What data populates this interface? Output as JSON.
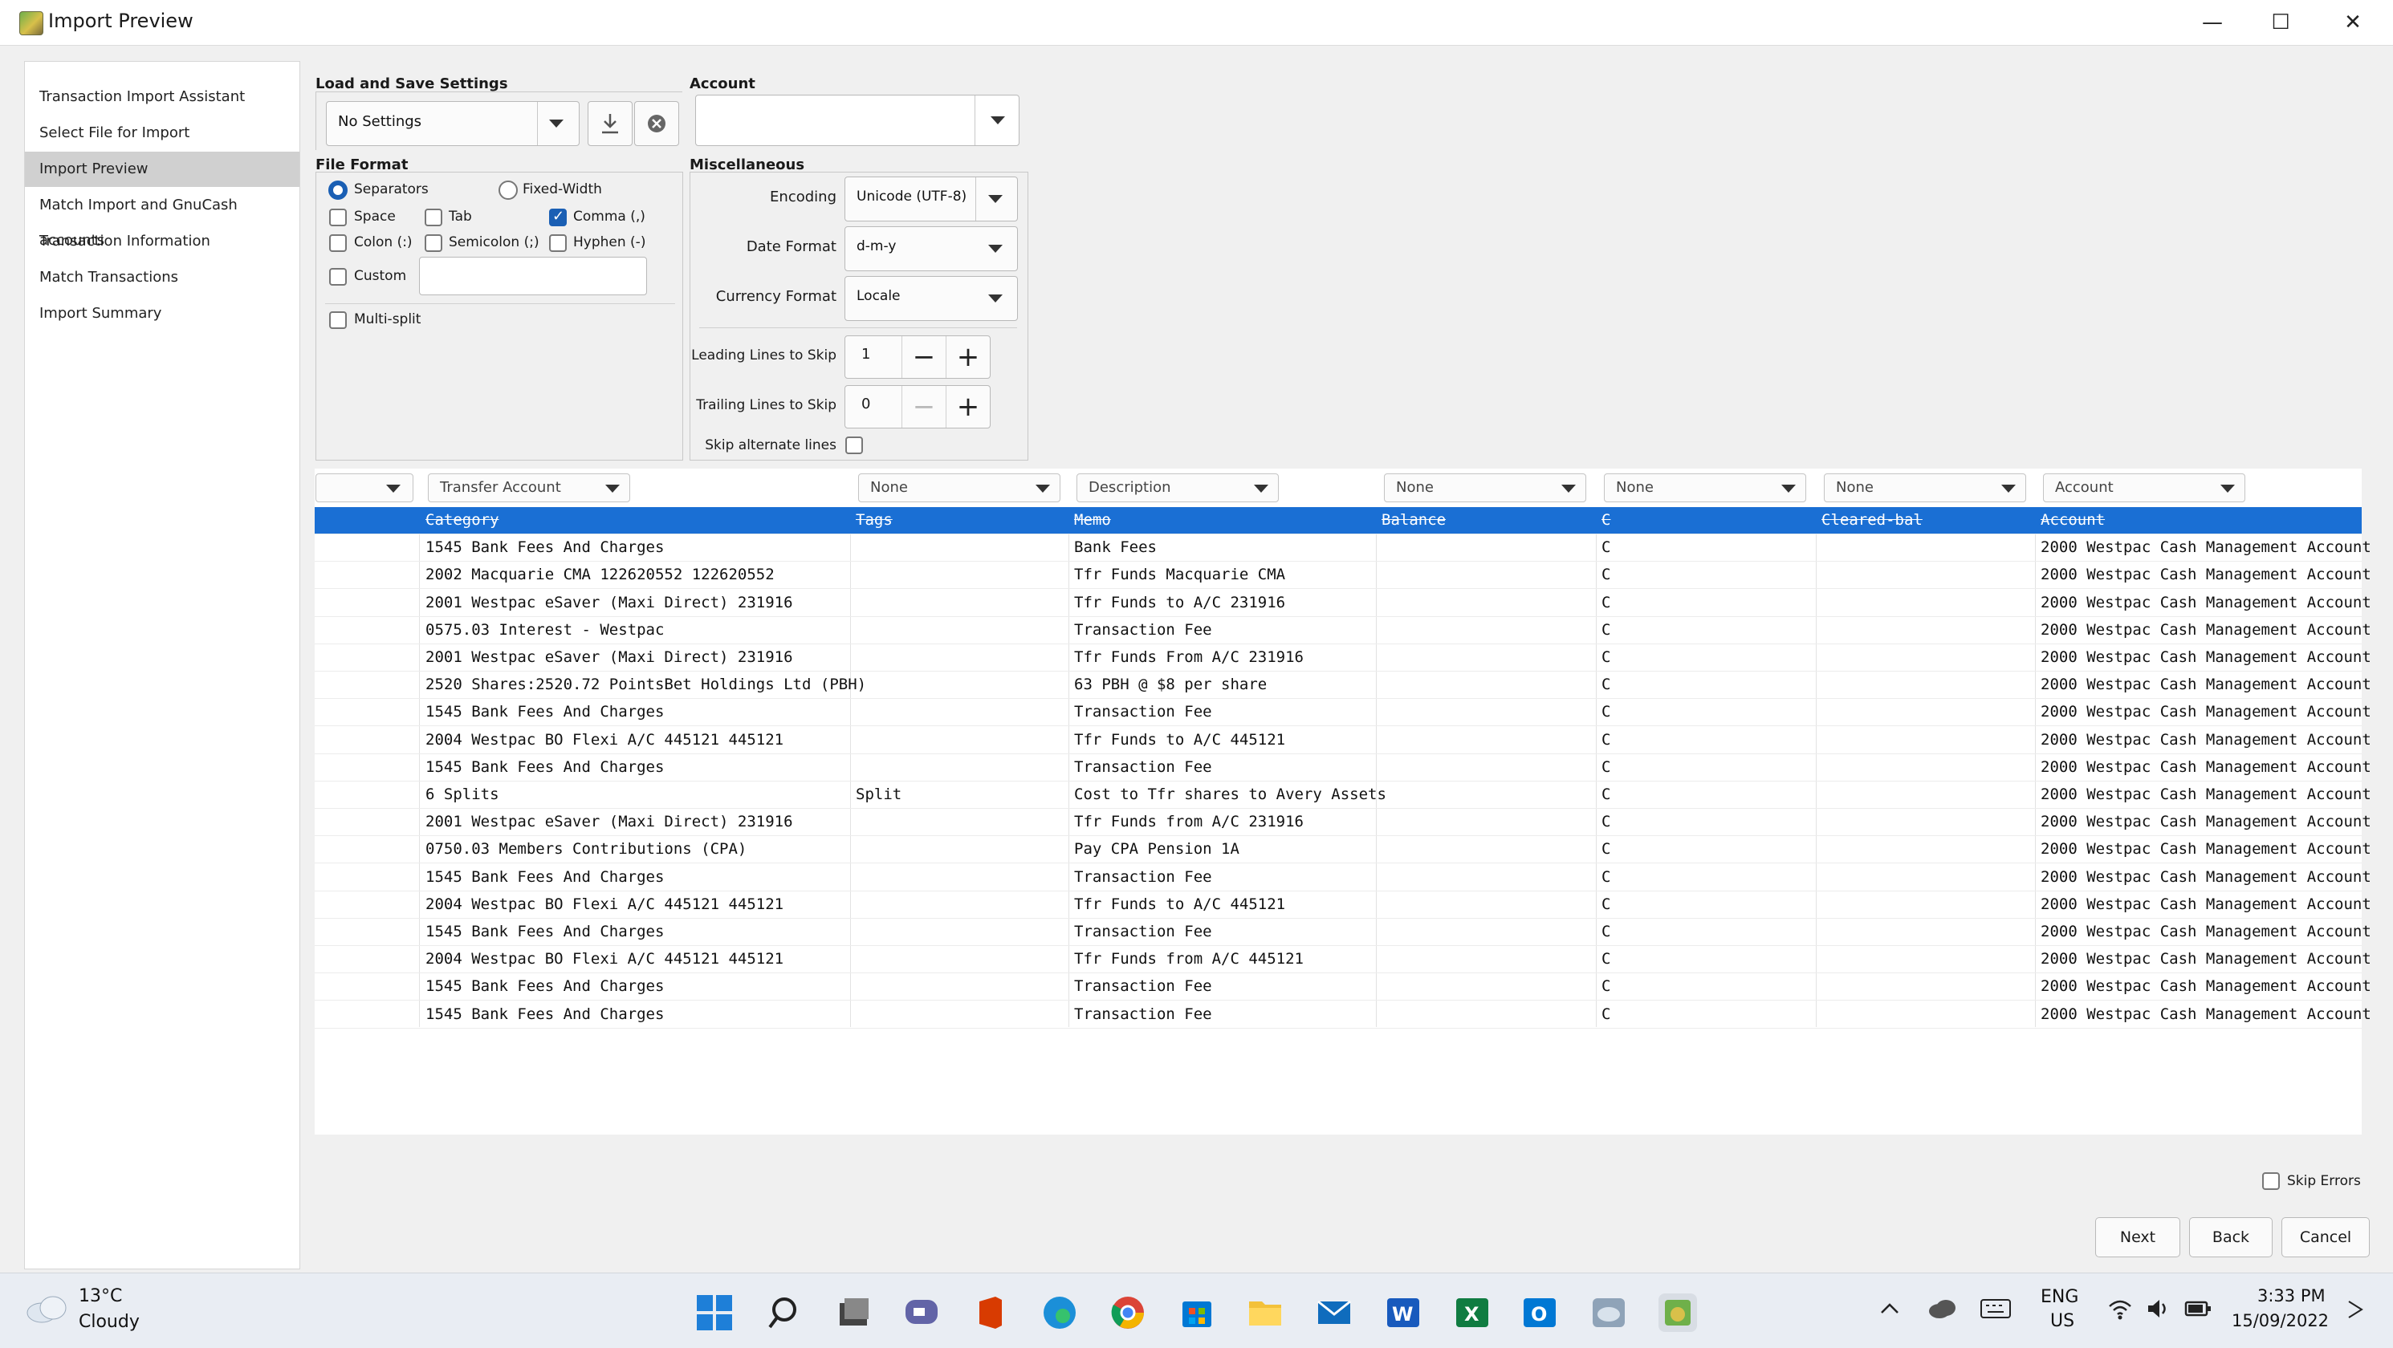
{
  "window": {
    "title": "Import Preview",
    "minimize": "—",
    "maximize": "☐",
    "close": "✕"
  },
  "sidebar": {
    "items": [
      {
        "label": "Transaction Import Assistant"
      },
      {
        "label": "Select File for Import"
      },
      {
        "label": "Import Preview"
      },
      {
        "label": "Match Import and GnuCash accounts"
      },
      {
        "label": "Transaction Information"
      },
      {
        "label": "Match Transactions"
      },
      {
        "label": "Import Summary"
      }
    ],
    "active_index": 2
  },
  "load_save": {
    "label": "Load and Save Settings",
    "value": "No Settings"
  },
  "account": {
    "label": "Account",
    "value": ""
  },
  "file_format": {
    "label": "File Format",
    "separators_label": "Separators",
    "fixed_width_label": "Fixed-Width",
    "separators_selected": true,
    "space_label": "Space",
    "tab_label": "Tab",
    "comma_label": "Comma (,)",
    "colon_label": "Colon (:)",
    "semicolon_label": "Semicolon (;)",
    "hyphen_label": "Hyphen (-)",
    "custom_label": "Custom",
    "custom_value": "",
    "multisplit_label": "Multi-split",
    "checked": {
      "space": false,
      "tab": false,
      "comma": true,
      "colon": false,
      "semicolon": false,
      "hyphen": false,
      "custom": false,
      "multisplit": false
    }
  },
  "misc": {
    "label": "Miscellaneous",
    "encoding_label": "Encoding",
    "encoding_value": "Unicode (UTF-8)",
    "date_format_label": "Date Format",
    "date_format_value": "d-m-y",
    "currency_format_label": "Currency Format",
    "currency_format_value": "Locale",
    "leading_lines_label": "Leading Lines to Skip",
    "leading_lines_value": "1",
    "trailing_lines_label": "Trailing Lines to Skip",
    "trailing_lines_value": "0",
    "skip_alternate_label": "Skip alternate lines",
    "skip_alternate_checked": false
  },
  "table": {
    "column_types": [
      "",
      "Transfer Account",
      "None",
      "Description",
      "None",
      "None",
      "None",
      "Account"
    ],
    "header_row": [
      "",
      "Category",
      "Tags",
      "Memo",
      "Balance",
      "C",
      "Cleared-bal",
      "Account"
    ],
    "rows": [
      [
        "",
        "1545 Bank Fees And Charges",
        "",
        "Bank Fees",
        "",
        "C",
        "",
        "2000 Westpac Cash Management Account"
      ],
      [
        "",
        "2002 Macquarie CMA 122620552 122620552",
        "",
        "Tfr Funds Macquarie CMA",
        "",
        "C",
        "",
        "2000 Westpac Cash Management Account"
      ],
      [
        "",
        "2001 Westpac eSaver (Maxi Direct) 231916",
        "",
        "Tfr Funds to A/C 231916",
        "",
        "C",
        "",
        "2000 Westpac Cash Management Account"
      ],
      [
        "",
        "0575.03 Interest - Westpac",
        "",
        "Transaction Fee",
        "",
        "C",
        "",
        "2000 Westpac Cash Management Account"
      ],
      [
        "",
        "2001 Westpac eSaver (Maxi Direct) 231916",
        "",
        "Tfr Funds From A/C 231916",
        "",
        "C",
        "",
        "2000 Westpac Cash Management Account"
      ],
      [
        "",
        "2520 Shares:2520.72 PointsBet Holdings Ltd (PBH)",
        "",
        "63 PBH @ $8 per share",
        "",
        "C",
        "",
        "2000 Westpac Cash Management Account"
      ],
      [
        "",
        "1545 Bank Fees And Charges",
        "",
        "Transaction Fee",
        "",
        "C",
        "",
        "2000 Westpac Cash Management Account"
      ],
      [
        "",
        "2004 Westpac BO Flexi A/C 445121 445121",
        "",
        "Tfr Funds to A/C 445121",
        "",
        "C",
        "",
        "2000 Westpac Cash Management Account"
      ],
      [
        "",
        "1545 Bank Fees And Charges",
        "",
        "Transaction Fee",
        "",
        "C",
        "",
        "2000 Westpac Cash Management Account"
      ],
      [
        "",
        "6 Splits",
        "Split",
        "Cost to Tfr shares to Avery Assets",
        "",
        "C",
        "",
        "2000 Westpac Cash Management Account"
      ],
      [
        "",
        "2001 Westpac eSaver (Maxi Direct) 231916",
        "",
        "Tfr Funds from A/C 231916",
        "",
        "C",
        "",
        "2000 Westpac Cash Management Account"
      ],
      [
        "",
        "0750.03 Members Contributions (CPA)",
        "",
        "Pay CPA Pension 1A",
        "",
        "C",
        "",
        "2000 Westpac Cash Management Account"
      ],
      [
        "",
        "1545 Bank Fees And Charges",
        "",
        "Transaction Fee",
        "",
        "C",
        "",
        "2000 Westpac Cash Management Account"
      ],
      [
        "",
        "2004 Westpac BO Flexi A/C 445121 445121",
        "",
        "Tfr Funds to A/C 445121",
        "",
        "C",
        "",
        "2000 Westpac Cash Management Account"
      ],
      [
        "",
        "1545 Bank Fees And Charges",
        "",
        "Transaction Fee",
        "",
        "C",
        "",
        "2000 Westpac Cash Management Account"
      ],
      [
        "",
        "2004 Westpac BO Flexi A/C 445121 445121",
        "",
        "Tfr Funds from A/C 445121",
        "",
        "C",
        "",
        "2000 Westpac Cash Management Account"
      ],
      [
        "",
        "1545 Bank Fees And Charges",
        "",
        "Transaction Fee",
        "",
        "C",
        "",
        "2000 Westpac Cash Management Account"
      ],
      [
        "",
        "1545 Bank Fees And Charges",
        "",
        "Transaction Fee",
        "",
        "C",
        "",
        "2000 Westpac Cash Management Account"
      ]
    ]
  },
  "skip_errors": {
    "label": "Skip Errors",
    "checked": false
  },
  "buttons": {
    "next": "Next",
    "back": "Back",
    "cancel": "Cancel"
  },
  "taskbar": {
    "weather_temp": "13°C",
    "weather_desc": "Cloudy",
    "lang_line1": "ENG",
    "lang_line2": "US",
    "time": "3:33 PM",
    "date": "15/09/2022",
    "icons": [
      "start-icon",
      "search-icon",
      "task-view-icon",
      "teams-chat-icon",
      "office-icon",
      "edge-icon",
      "chrome-icon",
      "store-icon",
      "file-explorer-icon",
      "mail-icon",
      "word-icon",
      "excel-icon",
      "outlook-icon",
      "weather-app-icon",
      "gnucash-icon"
    ]
  },
  "colors": {
    "selection": "#1a6fd4",
    "accent": "#1a5fb4"
  }
}
